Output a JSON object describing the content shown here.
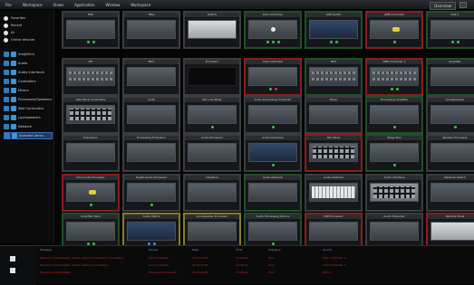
{
  "menubar": {
    "items": [
      "File",
      "Workspace",
      "Views",
      "Application",
      "Window",
      "Workspace"
    ],
    "view_switch": "Overview"
  },
  "sidebar": {
    "items": [
      {
        "label": "Favorites",
        "icon": "dot"
      },
      {
        "label": "Recent",
        "icon": "dot"
      },
      {
        "label": "All",
        "icon": "dot"
      },
      {
        "label": "Online devices",
        "icon": "dot"
      },
      {
        "label": "Amplifiers",
        "icon": "device"
      },
      {
        "label": "Audio",
        "icon": "device"
      },
      {
        "label": "Audio Interfaces",
        "icon": "device"
      },
      {
        "label": "Controllers",
        "icon": "device"
      },
      {
        "label": "Mixers",
        "icon": "device"
      },
      {
        "label": "Processors/Speakers",
        "icon": "device"
      },
      {
        "label": "Wall Controllers",
        "icon": "device"
      },
      {
        "label": "Loudspeakers",
        "icon": "device"
      },
      {
        "label": "Network",
        "icon": "device"
      },
      {
        "label": "Selected items",
        "icon": "device"
      }
    ],
    "selected_index": 13
  },
  "tiles": [
    {
      "name": "DSP",
      "border": "grey",
      "body": "light",
      "foot": [
        "green",
        "green"
      ]
    },
    {
      "name": "HDA",
      "border": "grey",
      "body": "light",
      "foot": []
    },
    {
      "name": "DCM-S",
      "border": "grey",
      "body": "white",
      "foot": []
    },
    {
      "name": "DCA Controller",
      "border": "green",
      "body": "light",
      "foot": [
        "green",
        "green",
        "green"
      ],
      "knob": "w"
    },
    {
      "name": "AVB Switch",
      "border": "green",
      "body": "blue",
      "foot": [
        "green",
        "green"
      ]
    },
    {
      "name": "AMP Controller",
      "border": "red",
      "body": "light",
      "foot": [
        "green"
      ],
      "knob": "y"
    },
    {
      "name": "DSP 1",
      "border": "green",
      "body": "light",
      "foot": [
        "green",
        "green"
      ]
    },
    {
      "name": "MX",
      "border": "grey",
      "body": "light",
      "foot": [],
      "strip": true
    },
    {
      "name": "MX2",
      "border": "grey",
      "body": "light",
      "foot": []
    },
    {
      "name": "Processor",
      "border": "grey",
      "body": "dark",
      "foot": []
    },
    {
      "name": "Amp Controller",
      "border": "red",
      "body": "light",
      "foot": [
        "green",
        "red"
      ]
    },
    {
      "name": "MX3",
      "border": "green",
      "body": "light",
      "foot": [],
      "strip": true
    },
    {
      "name": "AMP Controller 2",
      "border": "red",
      "body": "light",
      "foot": [
        "green",
        "green"
      ],
      "strip": true
    },
    {
      "name": "Amplifier",
      "border": "green",
      "body": "light",
      "foot": []
    },
    {
      "name": "Wall Panel Controllers",
      "border": "grey",
      "body": "light",
      "foot": [],
      "pads": true
    },
    {
      "name": "Audio",
      "border": "grey",
      "body": "light",
      "foot": []
    },
    {
      "name": "Mic-Line Mixer",
      "border": "grey",
      "body": "light",
      "foot": [
        "green"
      ]
    },
    {
      "name": "Audio Processing Controller",
      "border": "grey",
      "body": "light",
      "foot": [
        "green"
      ]
    },
    {
      "name": "Mixer",
      "border": "grey",
      "body": "light",
      "foot": []
    },
    {
      "name": "Processing Amplifier",
      "border": "green",
      "body": "light",
      "foot": [
        "green"
      ]
    },
    {
      "name": "Loudspeakers",
      "border": "grey",
      "body": "light",
      "foot": [
        "green"
      ]
    },
    {
      "name": "Expansion",
      "border": "grey",
      "body": "light",
      "foot": []
    },
    {
      "name": "Processing Extension",
      "border": "grey",
      "body": "light",
      "foot": []
    },
    {
      "name": "Audio Processor",
      "border": "grey",
      "body": "light",
      "foot": []
    },
    {
      "name": "Audio Controller",
      "border": "grey",
      "body": "blue",
      "foot": [
        "green"
      ]
    },
    {
      "name": "Mix Panel",
      "border": "red",
      "body": "light",
      "foot": [],
      "pads": true
    },
    {
      "name": "Stage Box",
      "border": "green",
      "body": "light",
      "foot": [
        "green"
      ]
    },
    {
      "name": "Speaker Processor",
      "border": "grey",
      "body": "light",
      "foot": []
    },
    {
      "name": "DCA Audio Processor",
      "border": "red",
      "body": "light",
      "foot": [
        "green"
      ],
      "knob": "y"
    },
    {
      "name": "Digital Audio Processor",
      "border": "grey",
      "body": "light",
      "foot": [
        "green"
      ]
    },
    {
      "name": "Interface",
      "border": "grey",
      "body": "light",
      "foot": []
    },
    {
      "name": "Audio Network",
      "border": "green",
      "body": "light",
      "foot": []
    },
    {
      "name": "Audio Switcher",
      "border": "grey",
      "body": "light",
      "foot": [],
      "keys": true
    },
    {
      "name": "Audio Interface",
      "border": "grey",
      "body": "grey",
      "foot": [],
      "pads": true
    },
    {
      "name": "Network Switch",
      "border": "grey",
      "body": "light",
      "foot": []
    },
    {
      "name": "Amplifier Rack",
      "border": "green",
      "body": "light",
      "foot": [
        "green",
        "green"
      ]
    },
    {
      "name": "Audio Matrix",
      "border": "yellow",
      "body": "blue",
      "foot": [
        "blue",
        "blue"
      ]
    },
    {
      "name": "Loudspeaker Processor",
      "border": "yellow",
      "body": "light",
      "foot": []
    },
    {
      "name": "Audio Processing Device",
      "border": "green",
      "body": "light",
      "foot": [
        "green"
      ]
    },
    {
      "name": "DSP Processor",
      "border": "red",
      "body": "light",
      "foot": []
    },
    {
      "name": "Audio Streamer",
      "border": "grey",
      "body": "light",
      "foot": []
    },
    {
      "name": "Remote Panel",
      "border": "red",
      "body": "white",
      "foot": []
    }
  ],
  "log": {
    "columns": [
      "Message",
      "Device",
      "Date",
      "Time",
      "Category",
      "Source"
    ],
    "rows": [
      [
        "Device is unreachable. Check network connection and status.",
        "Amp Controller",
        "21.11.2018",
        "13:48:12",
        "Error",
        "Amp Controller 1"
      ],
      [
        "Device is unreachable. Check network connection.",
        "Amp Controller",
        "21.11.2018",
        "13:48:12",
        "Error",
        "Amp Controller 2"
      ],
      [
        "Device is unreachable.",
        "DCA Audio Processor",
        "21.11.2018",
        "13:48:12",
        "Error",
        "DCA 1"
      ]
    ]
  }
}
